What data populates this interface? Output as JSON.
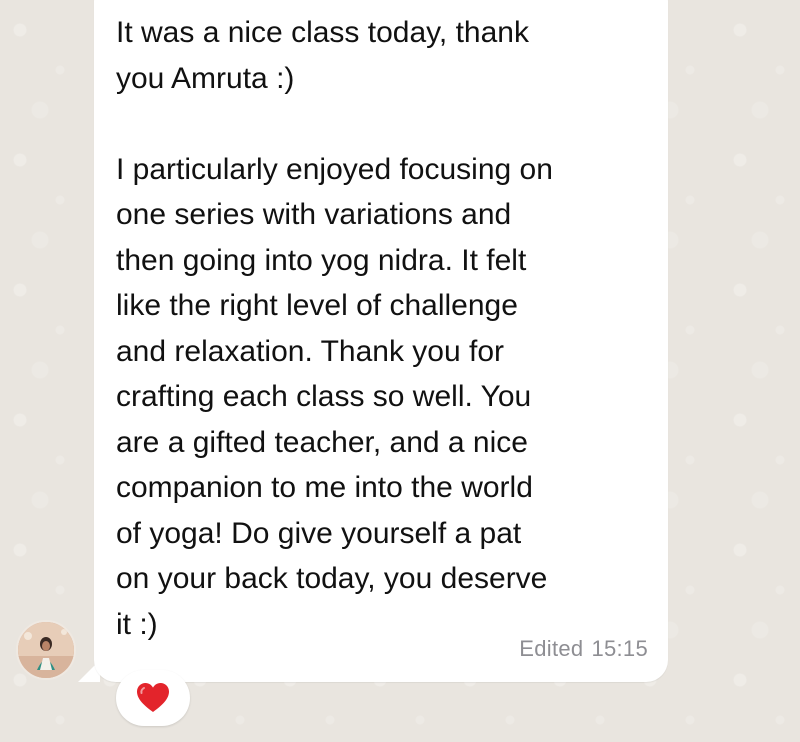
{
  "message": {
    "text": "It was a nice class today, thank\nyou Amruta :)\n\nI particularly enjoyed focusing on\none series with variations and\nthen going into yog nidra. It felt\nlike the right level of challenge\nand relaxation. Thank you for\ncrafting each class so well. You\nare a gifted teacher, and a nice\ncompanion to me into the world\nof yoga! Do give yourself a pat\non your back today, you deserve\nit :)",
    "edited_label": "Edited",
    "time": "15:15"
  },
  "reaction": {
    "icon": "heart-icon",
    "color": "#e3242b"
  },
  "colors": {
    "background": "#e9e5df",
    "bubble": "#ffffff",
    "meta_text": "#8e8e93"
  }
}
